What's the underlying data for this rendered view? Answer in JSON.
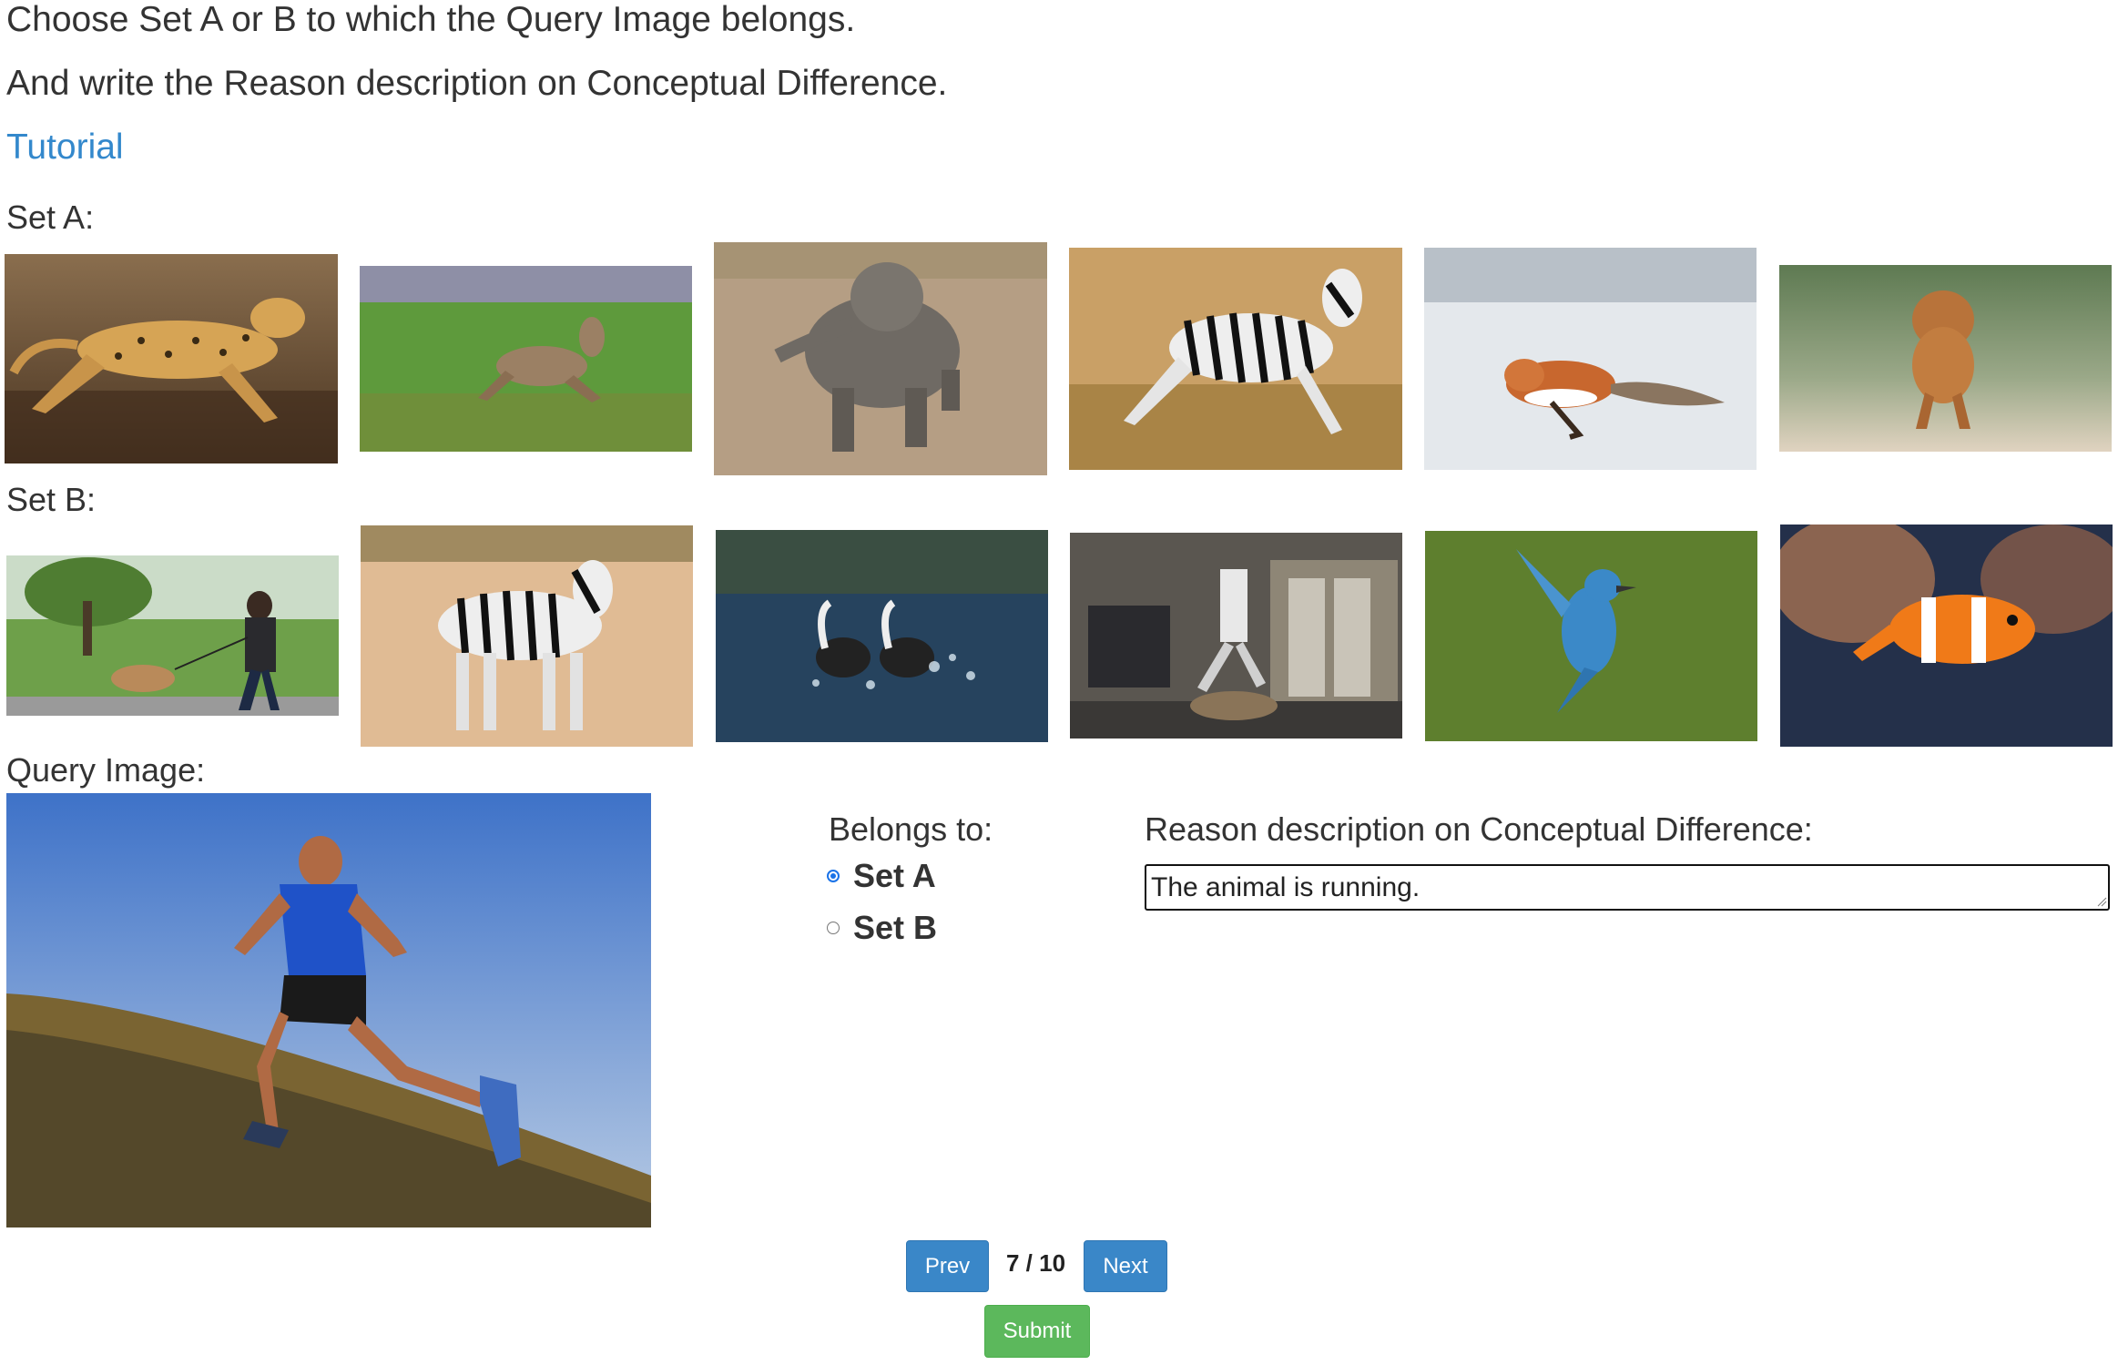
{
  "instructions": {
    "line1": "Choose Set A or B to which the Query Image belongs.",
    "line2": "And write the Reason description on Conceptual Difference."
  },
  "tutorial_link": "Tutorial",
  "set_a": {
    "label": "Set A:",
    "images": [
      "cheetah-running",
      "deer-leaping",
      "baby-elephant-running",
      "zebra-leaping",
      "fox-running-in-snow",
      "dog-jumping"
    ]
  },
  "set_b": {
    "label": "Set B:",
    "images": [
      "person-walking-dog",
      "zebra-standing",
      "grebes-running-on-water",
      "robot-jumping-log",
      "blue-bird-flying",
      "clownfish-swimming"
    ]
  },
  "query": {
    "label": "Query Image:",
    "image": "man-running-uphill"
  },
  "answer": {
    "belongs_label": "Belongs to:",
    "options": [
      {
        "label": "Set A",
        "checked": true
      },
      {
        "label": "Set B",
        "checked": false
      }
    ]
  },
  "reason": {
    "label": "Reason description on Conceptual Difference:",
    "value": "The animal is running."
  },
  "pagination": {
    "prev_label": "Prev",
    "next_label": "Next",
    "indicator": "7 / 10"
  },
  "submit_label": "Submit",
  "colors": {
    "link": "#3388cc",
    "primary_button": "#3a87c8",
    "submit_button": "#5cb85c",
    "radio_checked": "#1a73e8"
  }
}
